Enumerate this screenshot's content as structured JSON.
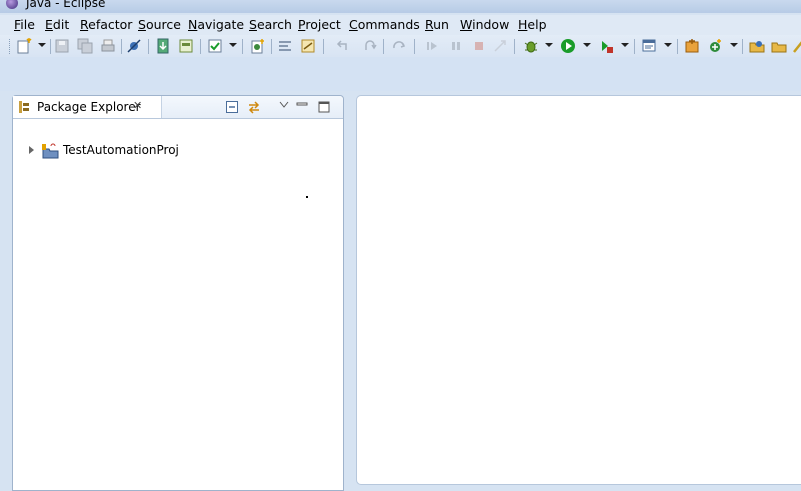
{
  "window": {
    "title": "Java - Eclipse",
    "app_icon": "eclipse-icon"
  },
  "menu": [
    {
      "key": "file",
      "label": "File"
    },
    {
      "key": "edit",
      "label": "Edit"
    },
    {
      "key": "refactor",
      "label": "Refactor"
    },
    {
      "key": "source",
      "label": "Source"
    },
    {
      "key": "navigate",
      "label": "Navigate"
    },
    {
      "key": "search",
      "label": "Search"
    },
    {
      "key": "project",
      "label": "Project"
    },
    {
      "key": "commands",
      "label": "Commands"
    },
    {
      "key": "run",
      "label": "Run"
    },
    {
      "key": "window",
      "label": "Window"
    },
    {
      "key": "help",
      "label": "Help"
    }
  ],
  "toolbar": {
    "buttons": [
      "new-icon",
      "save-icon",
      "save-all-icon",
      "print-icon",
      "skip-breakpoints-icon",
      "download-icon",
      "terminal-icon",
      "check-icon",
      "new-class-icon",
      "open-type-icon",
      "search-icon",
      "back-icon",
      "forward-icon",
      "next-edit-icon",
      "resume-icon",
      "suspend-icon",
      "terminate-icon",
      "disconnect-icon",
      "debug-icon",
      "run-icon",
      "external-tools-icon",
      "open-perspective-icon",
      "web-browser-icon",
      "add-icon",
      "open-folder-icon",
      "open-file-icon"
    ]
  },
  "package_explorer": {
    "tab_label": "Package Explorer",
    "close_glyph": "✕",
    "tree": [
      {
        "label": "TestAutomationProj",
        "icon": "java-project-icon"
      }
    ]
  },
  "colors": {
    "accent": "#d4e2f3",
    "panel_border": "#9fb3cc",
    "run_green": "#1a9c2a"
  }
}
